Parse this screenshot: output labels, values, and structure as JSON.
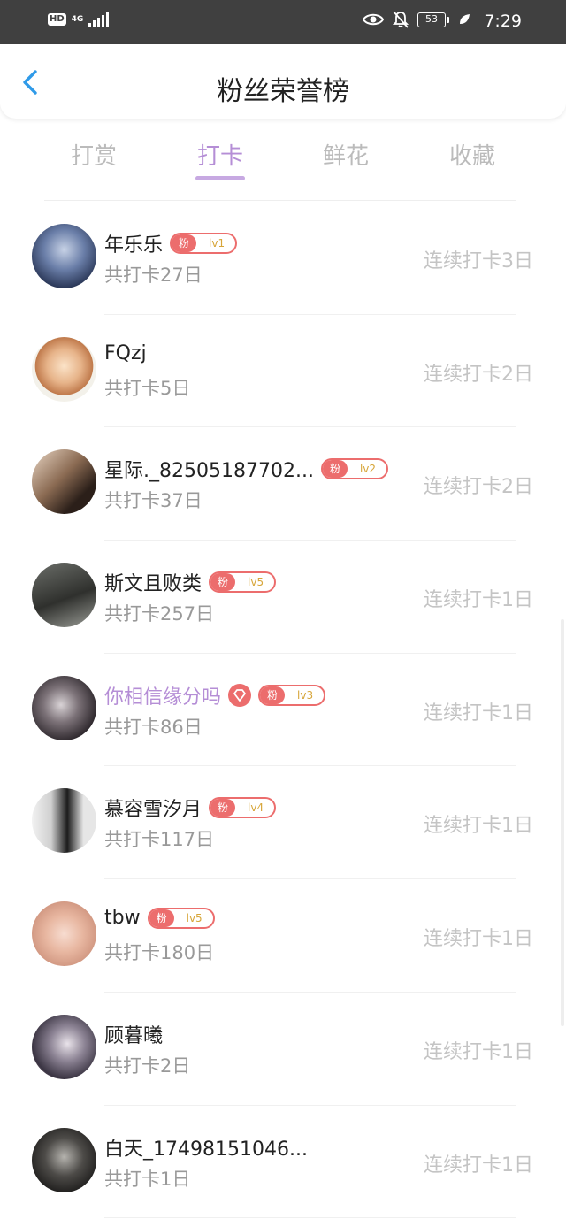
{
  "status_bar": {
    "hd": "HD",
    "network": "4G",
    "battery": "53",
    "time": "7:29"
  },
  "header": {
    "title": "粉丝荣誉榜"
  },
  "tabs": [
    {
      "label": "打赏"
    },
    {
      "label": "打卡"
    },
    {
      "label": "鲜花"
    },
    {
      "label": "收藏"
    }
  ],
  "active_tab": "打卡",
  "fan_label": "粉",
  "colors": {
    "accent": "#b58ed6",
    "badge": "#ec6d6d",
    "level_text": "#d7a63a"
  },
  "list": [
    {
      "name": "年乐乐",
      "level": "lv1",
      "total": "共打卡27日",
      "streak": "连续打卡3日"
    },
    {
      "name": "FQzj",
      "level": "",
      "total": "共打卡5日",
      "streak": "连续打卡2日"
    },
    {
      "name": "星际._82505187702...",
      "level": "lv2",
      "total": "共打卡37日",
      "streak": "连续打卡2日"
    },
    {
      "name": "斯文且败类",
      "level": "lv5",
      "total": "共打卡257日",
      "streak": "连续打卡1日"
    },
    {
      "name": "你相信缘分吗",
      "level": "lv3",
      "total": "共打卡86日",
      "streak": "连续打卡1日",
      "vip": true
    },
    {
      "name": "慕容雪汐月",
      "level": "lv4",
      "total": "共打卡117日",
      "streak": "连续打卡1日"
    },
    {
      "name": "tbw",
      "level": "lv5",
      "total": "共打卡180日",
      "streak": "连续打卡1日"
    },
    {
      "name": "顾暮曦",
      "level": "",
      "total": "共打卡2日",
      "streak": "连续打卡1日"
    },
    {
      "name": "白天_17498151046...",
      "level": "",
      "total": "共打卡1日",
      "streak": "连续打卡1日"
    }
  ]
}
